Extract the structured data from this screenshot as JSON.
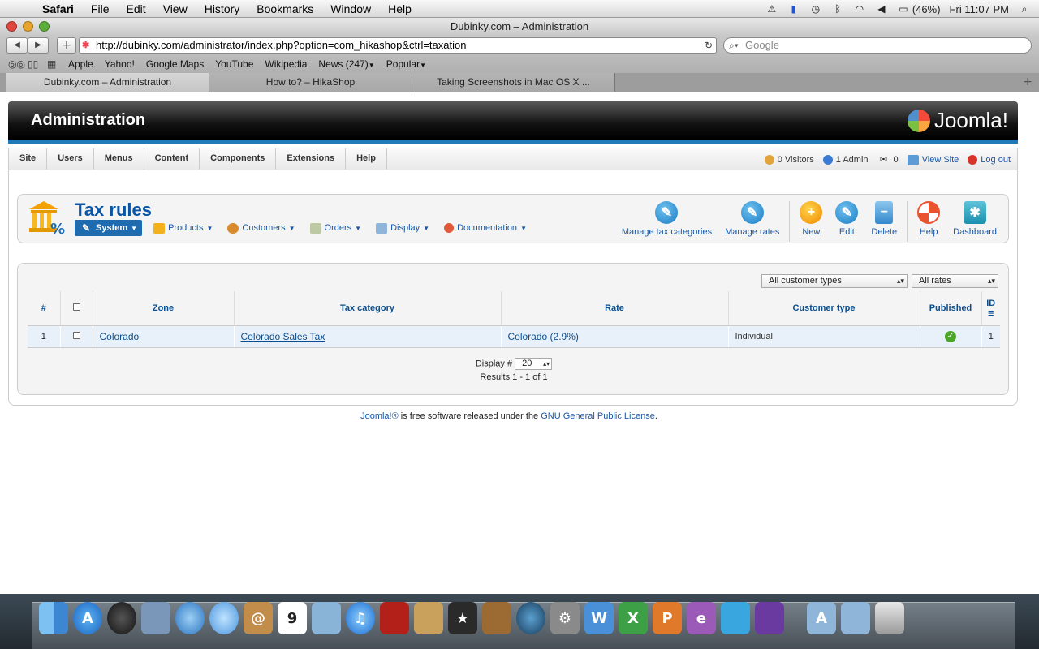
{
  "menubar": {
    "app": "Safari",
    "items": [
      "File",
      "Edit",
      "View",
      "History",
      "Bookmarks",
      "Window",
      "Help"
    ],
    "battery": "(46%)",
    "clock": "Fri 11:07 PM"
  },
  "window": {
    "title": "Dubinky.com – Administration",
    "url": "http://dubinky.com/administrator/index.php?option=com_hikashop&ctrl=taxation",
    "search_placeholder": "Google",
    "bookmarks": [
      "Apple",
      "Yahoo!",
      "Google Maps",
      "YouTube",
      "Wikipedia",
      "News (247)",
      "Popular"
    ],
    "tabs": [
      {
        "label": "Dubinky.com – Administration",
        "active": true
      },
      {
        "label": "How to? – HikaShop",
        "active": false
      },
      {
        "label": "Taking Screenshots in Mac OS X ...",
        "active": false
      }
    ]
  },
  "joomla": {
    "header_title": "Administration",
    "logo_text": "Joomla!",
    "menu": [
      "Site",
      "Users",
      "Menus",
      "Content",
      "Components",
      "Extensions",
      "Help"
    ],
    "status": {
      "visitors": "0 Visitors",
      "admins": "1 Admin",
      "messages": "0",
      "view_site": "View Site",
      "logout": "Log out"
    }
  },
  "toolbar": {
    "page_title": "Tax rules",
    "hikamenu": [
      "System",
      "Products",
      "Customers",
      "Orders",
      "Display",
      "Documentation"
    ],
    "buttons": {
      "manage_tax_categories": "Manage tax categories",
      "manage_rates": "Manage rates",
      "new": "New",
      "edit": "Edit",
      "delete": "Delete",
      "help": "Help",
      "dashboard": "Dashboard"
    }
  },
  "listing": {
    "filter_customer_type": "All customer types",
    "filter_rates": "All rates",
    "columns": {
      "num": "#",
      "zone": "Zone",
      "tax_category": "Tax category",
      "rate": "Rate",
      "customer_type": "Customer type",
      "published": "Published",
      "id": "ID"
    },
    "rows": [
      {
        "num": "1",
        "zone": "Colorado",
        "tax_category": "Colorado Sales Tax",
        "rate": "Colorado (2.9%)",
        "customer_type": "Individual",
        "published": true,
        "id": "1"
      }
    ],
    "display_label": "Display #",
    "display_value": "20",
    "results": "Results 1 - 1 of 1"
  },
  "footer": {
    "joomla_link": "Joomla!®",
    "text": " is free software released under the ",
    "license_link": "GNU General Public License",
    "end": "."
  },
  "colors": {
    "joomla_blue": "#0b55a5",
    "header_stripe": "#1e7ab8",
    "row_bg": "#e8f1f9",
    "published_green": "#4ba62a"
  }
}
